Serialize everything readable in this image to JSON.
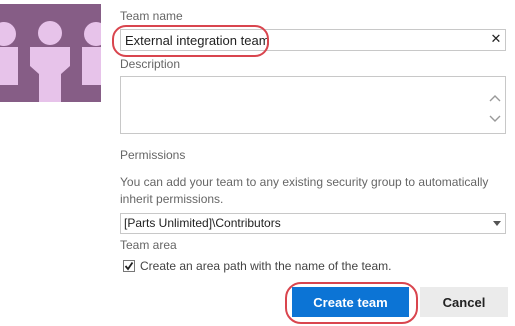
{
  "form": {
    "team_name_label": "Team name",
    "team_name_value": "External integration team",
    "description_label": "Description",
    "description_value": "",
    "permissions_label": "Permissions",
    "permissions_help": "You can add your team to any existing security group to automatically inherit permissions.",
    "permissions_selected": "[Parts Unlimited]\\Contributors",
    "team_area_label": "Team area",
    "create_area_path_label": "Create an area path with the name of the team.",
    "create_area_path_checked": true
  },
  "actions": {
    "create_label": "Create team",
    "cancel_label": "Cancel"
  },
  "icons": {
    "avatar": "team-icon",
    "clear": "close-icon"
  },
  "colors": {
    "avatar_bg": "#865d86",
    "avatar_fg": "#e7c3ea",
    "primary_button": "#0c74d5",
    "highlight": "#d9454e"
  }
}
